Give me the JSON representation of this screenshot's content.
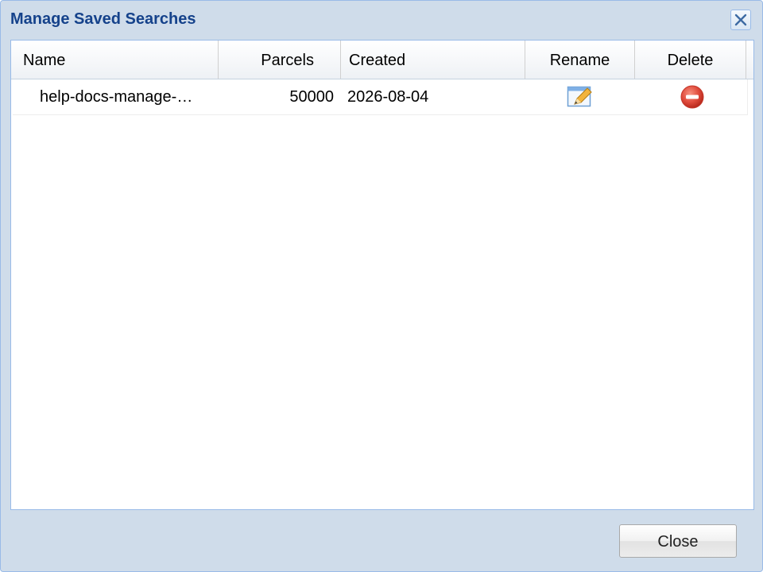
{
  "dialog": {
    "title": "Manage Saved Searches",
    "close_icon": "close-x-icon"
  },
  "grid": {
    "columns": {
      "name": "Name",
      "parcels": "Parcels",
      "created": "Created",
      "rename": "Rename",
      "delete": "Delete"
    },
    "rows": [
      {
        "name": "help-docs-manage-…",
        "parcels": "50000",
        "created": "2026-08-04",
        "rename_icon": "pencil-edit-icon",
        "delete_icon": "delete-minus-icon"
      }
    ]
  },
  "footer": {
    "close_label": "Close"
  },
  "colors": {
    "title": "#15428b",
    "dialog_bg": "#cfdcea",
    "border": "#99bbe8",
    "delete_red": "#e04b3c"
  }
}
